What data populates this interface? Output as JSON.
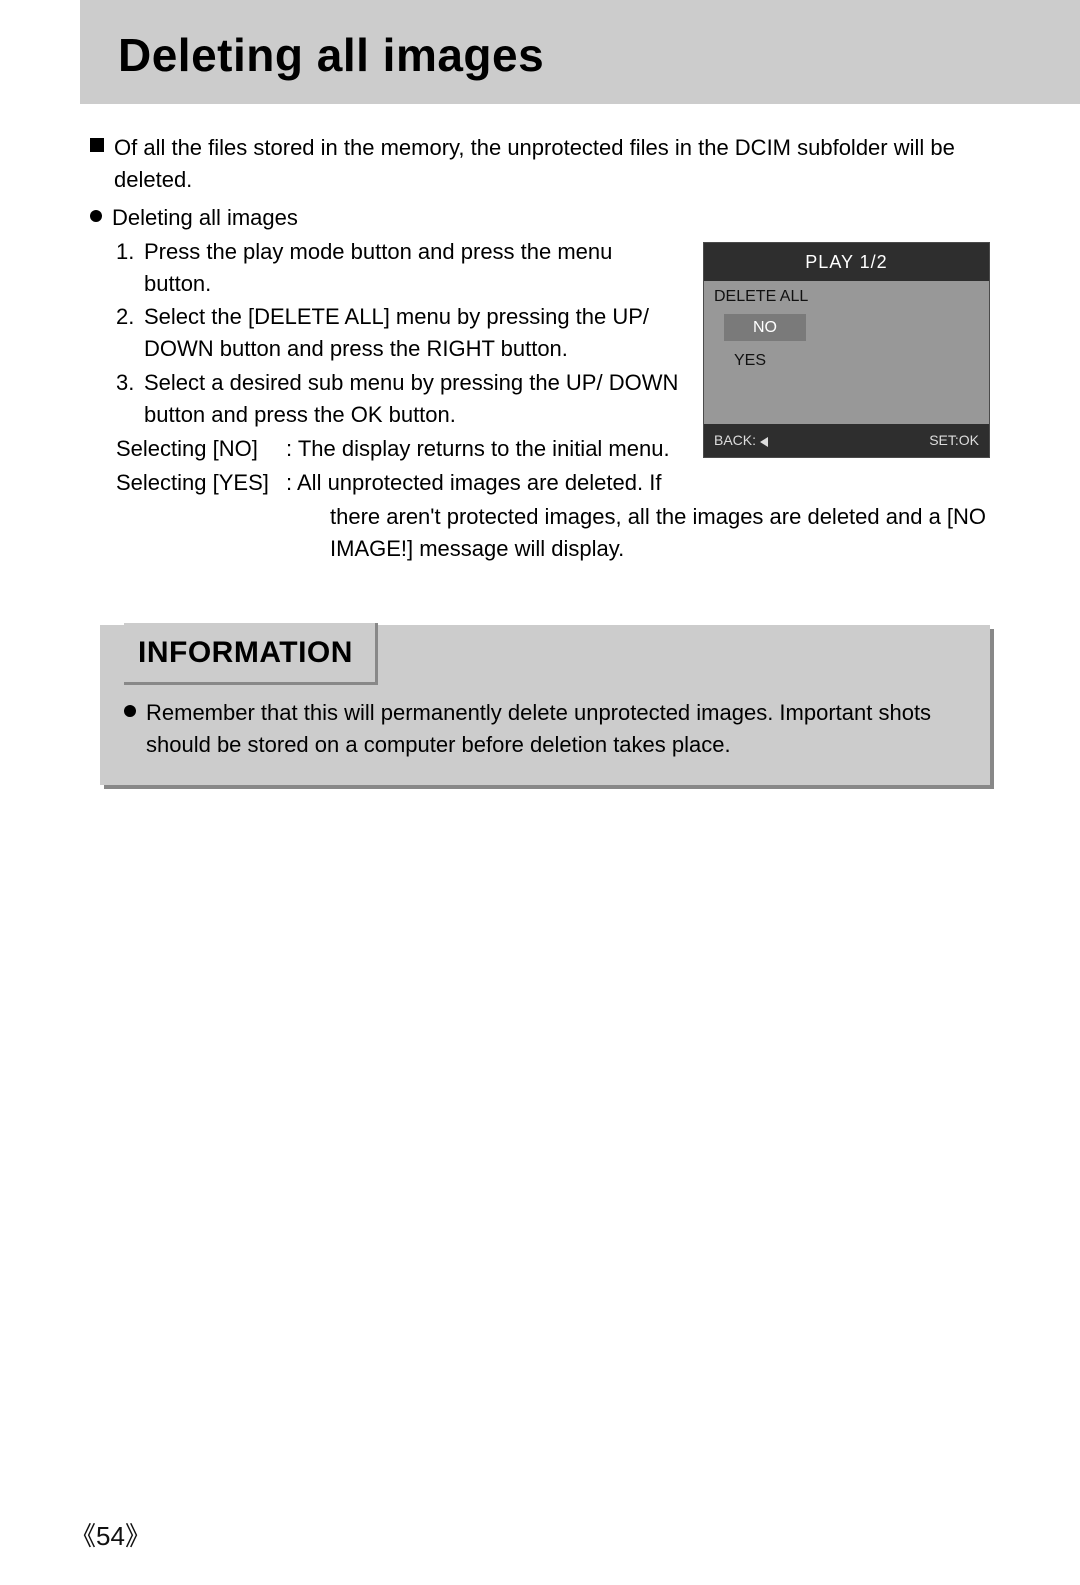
{
  "title": "Deleting all images",
  "intro": "Of all the files stored in the memory, the unprotected files in the DCIM subfolder will be deleted.",
  "subhead": "Deleting all images",
  "steps": {
    "s1": "Press the play mode button and press the menu button.",
    "s2": "Select the [DELETE ALL] menu by pressing the UP/ DOWN button and press the RIGHT button.",
    "s3": "Select a desired sub menu by pressing the UP/ DOWN button and press the OK button."
  },
  "select_no_label": "Selecting [NO]",
  "select_no_text": ": The display returns to the initial menu.",
  "select_yes_label": "Selecting [YES]",
  "select_yes_text": ": All unprotected images are deleted. If",
  "select_yes_wrap": "there aren't protected images, all the images are deleted and a [NO IMAGE!] message will display.",
  "cam": {
    "header": "PLAY 1/2",
    "menu_title": "DELETE ALL",
    "opt_no": "NO",
    "opt_yes": "YES",
    "footer_back": "BACK:",
    "footer_set": "SET:OK"
  },
  "info_label": "INFORMATION",
  "info_text": "Remember that this will permanently delete unprotected images. Important shots should be stored on a computer before deletion takes place.",
  "page_number": "54"
}
